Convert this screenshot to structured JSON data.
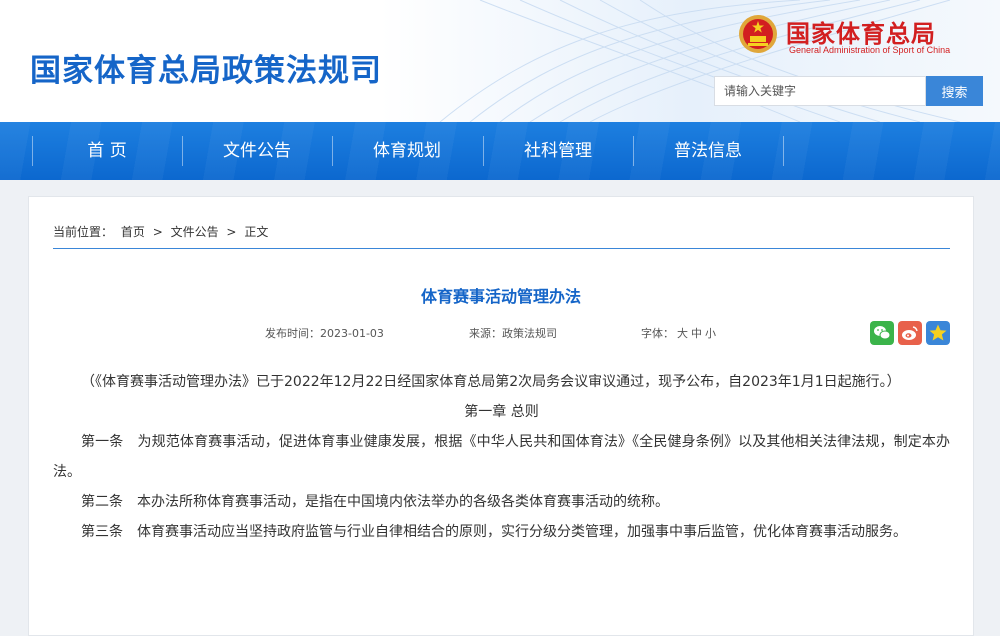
{
  "header": {
    "site_title": "国家体育总局政策法规司",
    "org_name_cn": "国家体育总局",
    "org_name_en": "General Administration of Sport of China",
    "search_placeholder": "请输入关键字",
    "search_button": "搜索"
  },
  "nav": {
    "items": [
      {
        "label": "首 页"
      },
      {
        "label": "文件公告"
      },
      {
        "label": "体育规划"
      },
      {
        "label": "社科管理"
      },
      {
        "label": "普法信息"
      }
    ]
  },
  "breadcrumb": {
    "prefix": "当前位置：",
    "items": [
      "首页",
      "文件公告",
      "正文"
    ],
    "separator": ">"
  },
  "article": {
    "title": "体育赛事活动管理办法",
    "date_label": "发布时间：2023-01-03",
    "source_label": "来源：政策法规司",
    "font_size_label": "字体：",
    "font_sizes": [
      "大",
      "中",
      "小"
    ],
    "paragraphs": [
      "（《体育赛事活动管理办法》已于2022年12月22日经国家体育总局第2次局务会议审议通过，现予公布，自2023年1月1日起施行。）",
      "第一章 总则",
      "第一条　为规范体育赛事活动，促进体育事业健康发展，根据《中华人民共和国体育法》《全民健身条例》以及其他相关法律法规，制定本办法。",
      "第二条　本办法所称体育赛事活动，是指在中国境内依法举办的各级各类体育赛事活动的统称。",
      "第三条　体育赛事活动应当坚持政府监管与行业自律相结合的原则，实行分级分类管理，加强事中事后监管，优化体育赛事活动服务。"
    ]
  },
  "share": {
    "icons": [
      "wechat-icon",
      "weibo-icon",
      "favorite-star-icon"
    ],
    "colors": {
      "wechat": "#3bb44a",
      "weibo": "#e8614b",
      "favorite": "#3a86d8"
    }
  },
  "colors": {
    "brand_blue": "#1565c8",
    "nav_blue": "#0c68cf",
    "org_red": "#d21f20"
  }
}
